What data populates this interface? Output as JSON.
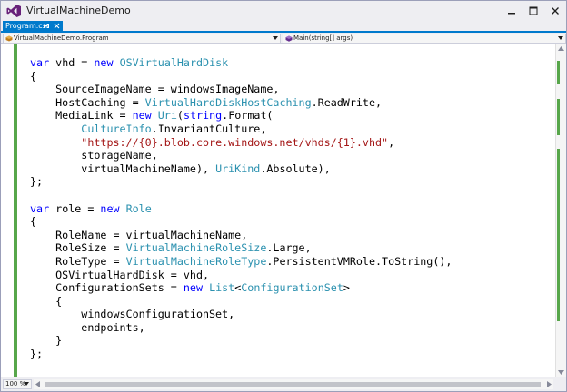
{
  "window": {
    "title": "VirtualMachineDemo"
  },
  "tab": {
    "label": "Program.cs"
  },
  "navigation": {
    "type_selector": "VirtualMachineDemo.Program",
    "member_selector": "Main(string[] args)"
  },
  "editor": {
    "zoom": "100 %",
    "lines": [
      [
        {
          "t": "var",
          "c": "kw"
        },
        {
          "t": " vhd = "
        },
        {
          "t": "new",
          "c": "kw"
        },
        {
          "t": " "
        },
        {
          "t": "OSVirtualHardDisk",
          "c": "ty"
        }
      ],
      [
        {
          "t": "{"
        }
      ],
      [
        {
          "t": "    SourceImageName = windowsImageName,"
        }
      ],
      [
        {
          "t": "    HostCaching = "
        },
        {
          "t": "VirtualHardDiskHostCaching",
          "c": "ty"
        },
        {
          "t": ".ReadWrite,"
        }
      ],
      [
        {
          "t": "    MediaLink = "
        },
        {
          "t": "new",
          "c": "kw"
        },
        {
          "t": " "
        },
        {
          "t": "Uri",
          "c": "ty"
        },
        {
          "t": "("
        },
        {
          "t": "string",
          "c": "kw"
        },
        {
          "t": ".Format("
        }
      ],
      [
        {
          "t": "        "
        },
        {
          "t": "CultureInfo",
          "c": "ty"
        },
        {
          "t": ".InvariantCulture,"
        }
      ],
      [
        {
          "t": "        "
        },
        {
          "t": "\"https://{0}.blob.core.windows.net/vhds/{1}.vhd\"",
          "c": "st"
        },
        {
          "t": ","
        }
      ],
      [
        {
          "t": "        storageName,"
        }
      ],
      [
        {
          "t": "        virtualMachineName), "
        },
        {
          "t": "UriKind",
          "c": "ty"
        },
        {
          "t": ".Absolute),"
        }
      ],
      [
        {
          "t": "};"
        }
      ],
      [
        {
          "t": ""
        }
      ],
      [
        {
          "t": "var",
          "c": "kw"
        },
        {
          "t": " role = "
        },
        {
          "t": "new",
          "c": "kw"
        },
        {
          "t": " "
        },
        {
          "t": "Role",
          "c": "ty"
        }
      ],
      [
        {
          "t": "{"
        }
      ],
      [
        {
          "t": "    RoleName = virtualMachineName,"
        }
      ],
      [
        {
          "t": "    RoleSize = "
        },
        {
          "t": "VirtualMachineRoleSize",
          "c": "ty"
        },
        {
          "t": ".Large,"
        }
      ],
      [
        {
          "t": "    RoleType = "
        },
        {
          "t": "VirtualMachineRoleType",
          "c": "ty"
        },
        {
          "t": ".PersistentVMRole.ToString(),"
        }
      ],
      [
        {
          "t": "    OSVirtualHardDisk = vhd,"
        }
      ],
      [
        {
          "t": "    ConfigurationSets = "
        },
        {
          "t": "new",
          "c": "kw"
        },
        {
          "t": " "
        },
        {
          "t": "List",
          "c": "ty"
        },
        {
          "t": "<"
        },
        {
          "t": "ConfigurationSet",
          "c": "ty"
        },
        {
          "t": ">"
        }
      ],
      [
        {
          "t": "    {"
        }
      ],
      [
        {
          "t": "        windowsConfigurationSet,"
        }
      ],
      [
        {
          "t": "        endpoints,"
        }
      ],
      [
        {
          "t": "    }"
        }
      ],
      [
        {
          "t": "};"
        }
      ]
    ]
  },
  "colors": {
    "accent": "#007acc",
    "keyword": "#0000ff",
    "type": "#2b91af",
    "string": "#a31515",
    "change_marker": "#57a64a"
  },
  "icons": {
    "app": "visual-studio-icon",
    "minimize": "minimize-icon",
    "maximize": "maximize-icon",
    "close": "close-icon"
  }
}
